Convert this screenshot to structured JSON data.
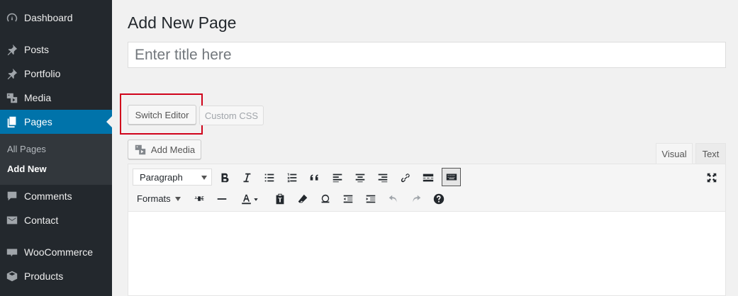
{
  "sidebar": {
    "items": [
      {
        "label": "Dashboard",
        "icon": "dashboard-icon"
      },
      {
        "label": "Posts",
        "icon": "pin-icon"
      },
      {
        "label": "Portfolio",
        "icon": "pin-icon"
      },
      {
        "label": "Media",
        "icon": "media-icon"
      },
      {
        "label": "Pages",
        "icon": "pages-icon",
        "active": true
      },
      {
        "label": "Comments",
        "icon": "comment-icon"
      },
      {
        "label": "Contact",
        "icon": "mail-icon"
      },
      {
        "label": "WooCommerce",
        "icon": "woo-icon"
      },
      {
        "label": "Products",
        "icon": "box-icon"
      }
    ],
    "submenu": {
      "all_pages": "All Pages",
      "add_new": "Add New"
    }
  },
  "main": {
    "title": "Add New Page",
    "title_input_placeholder": "Enter title here",
    "switch_editor": "Switch Editor",
    "custom_css": "Custom CSS",
    "add_media": "Add Media",
    "tab_visual": "Visual",
    "tab_text": "Text"
  },
  "toolbar": {
    "paragraph": "Paragraph",
    "formats": "Formats"
  },
  "colors": {
    "sidebar_bg": "#23282d",
    "active_bg": "#0073aa",
    "highlight": "#d0021b"
  }
}
